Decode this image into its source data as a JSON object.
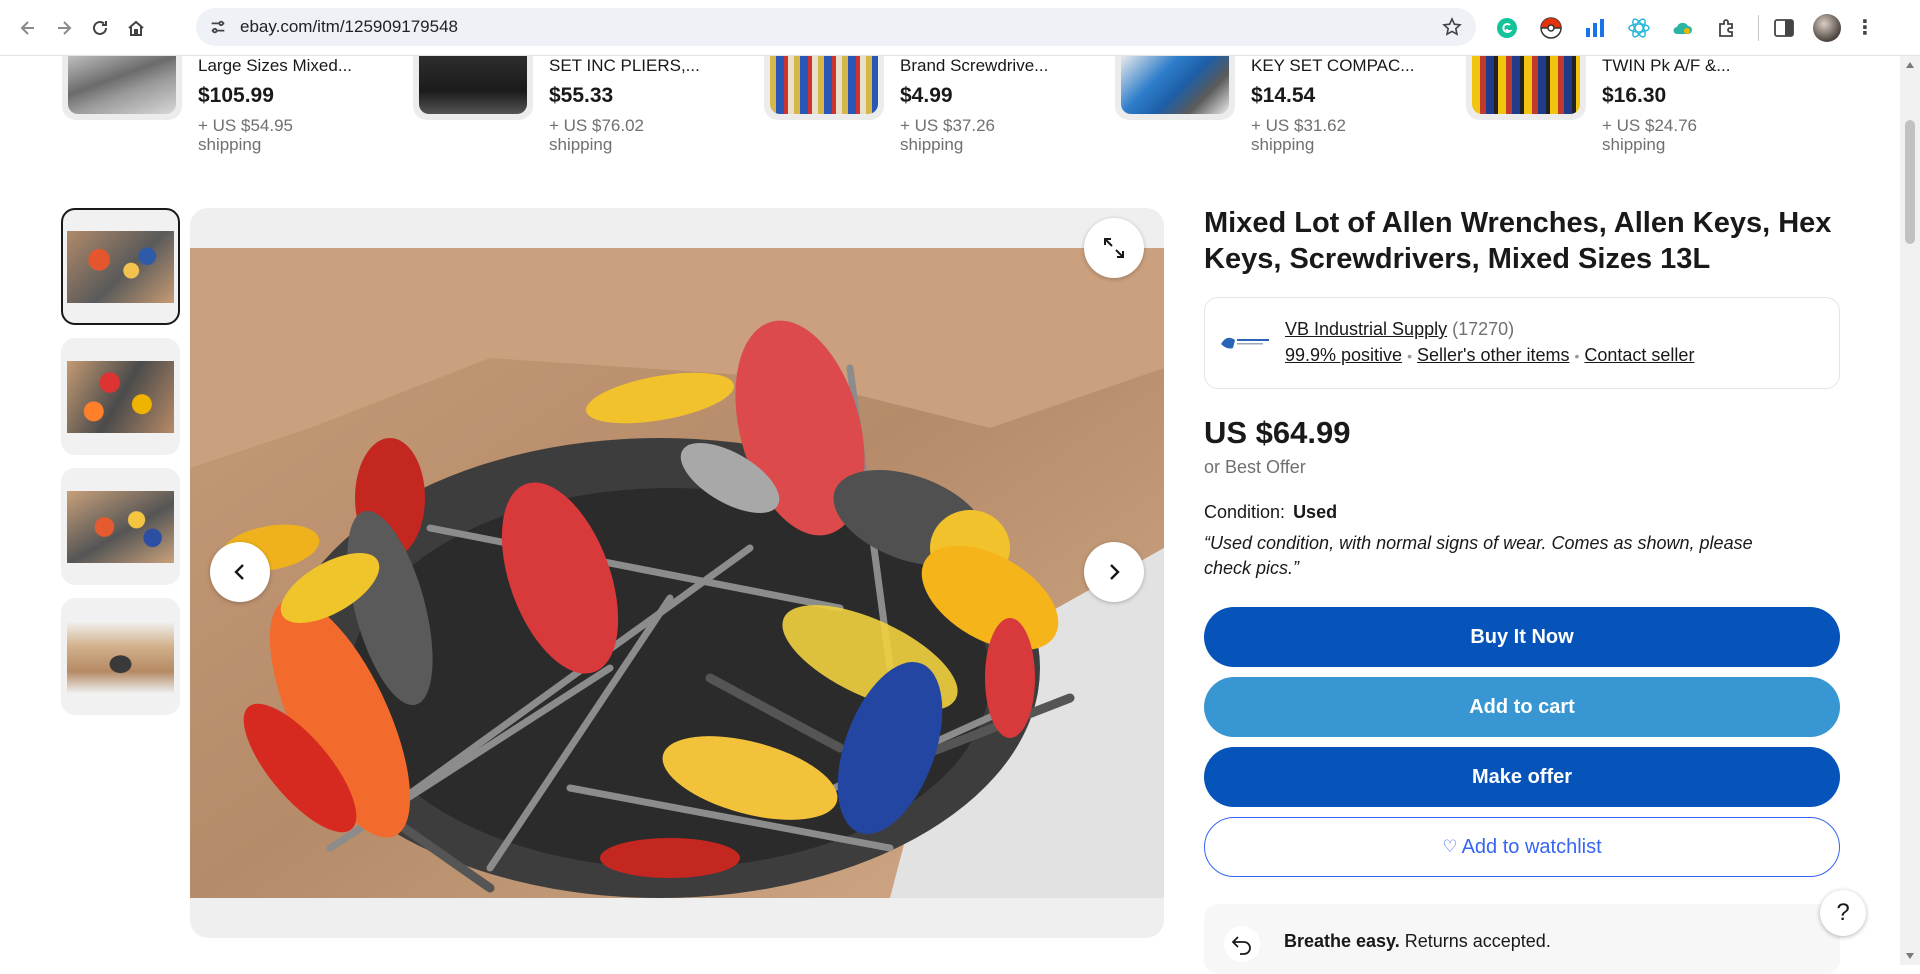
{
  "browser": {
    "url": "ebay.com/itm/125909179548",
    "icons": [
      "back-arrow-icon",
      "forward-arrow-icon",
      "reload-icon",
      "home-icon",
      "site-info-icon",
      "bookmark-star-icon",
      "grammarly-icon",
      "pokeball-icon",
      "analytics-icon",
      "atom-icon",
      "cloud-icon",
      "puzzle-extensions-icon",
      "sidebar-icon",
      "profile-avatar",
      "menu-kebab-icon"
    ]
  },
  "similar_items": [
    {
      "title": "Large Sizes Mixed...",
      "price": "$105.99",
      "shipping": "+ US $54.95 shipping"
    },
    {
      "title": "SET INC PLIERS,...",
      "price": "$55.33",
      "shipping": "+ US $76.02 shipping"
    },
    {
      "title": "Brand Screwdrive...",
      "price": "$4.99",
      "shipping": "+ US $37.26 shipping"
    },
    {
      "title": "KEY SET COMPAC...",
      "price": "$14.54",
      "shipping": "+ US $31.62 shipping"
    },
    {
      "title": "TWIN Pk A/F &...",
      "price": "$16.30",
      "shipping": "+ US $24.76 shipping"
    }
  ],
  "gallery": {
    "thumbnail_count": 4,
    "selected_index": 0
  },
  "listing": {
    "title": "Mixed Lot of Allen Wrenches, Allen Keys, Hex Keys, Screwdrivers, Mixed Sizes 13L",
    "seller": {
      "name": "VB Industrial Supply",
      "feedback_count": "(17270)",
      "positive": "99.9% positive",
      "other_items": "Seller's other items",
      "contact": "Contact seller"
    },
    "price": "US $64.99",
    "best_offer": "or Best Offer",
    "condition_label": "Condition:",
    "condition_value": "Used",
    "condition_note": "“Used condition, with normal signs of wear. Comes as shown, please check pics.”",
    "buttons": {
      "buy_now": "Buy It Now",
      "add_to_cart": "Add to cart",
      "make_offer": "Make offer",
      "watchlist": "Add to watchlist"
    },
    "returns": {
      "bold": "Breathe easy.",
      "text": " Returns accepted."
    }
  },
  "help": "?",
  "colors": {
    "primary_blue": "#0654ba",
    "cart_blue": "#3897d3",
    "link_blue": "#3665f3"
  }
}
